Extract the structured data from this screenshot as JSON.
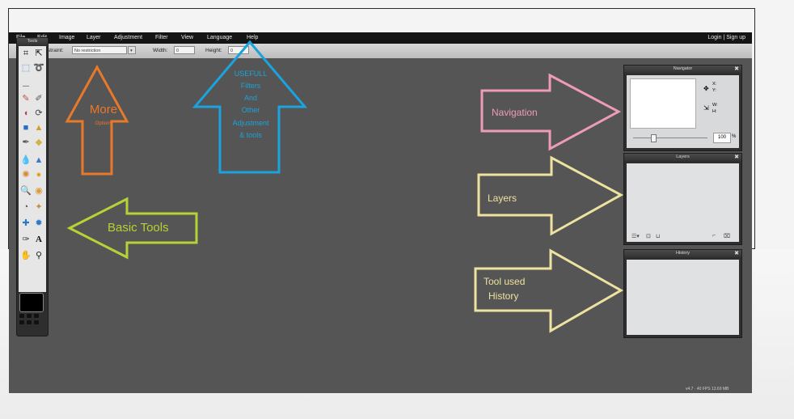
{
  "menu": {
    "items": [
      "File",
      "Edit",
      "Image",
      "Layer",
      "Adjustment",
      "Filter",
      "View",
      "Language",
      "Help"
    ],
    "login": "Login",
    "separator": "|",
    "signup": "Sign up"
  },
  "options": {
    "constraint_label": "Constraint:",
    "constraint_value": "No restriction",
    "width_label": "Width:",
    "width_value": "0",
    "height_label": "Height:",
    "height_value": "0"
  },
  "panels": {
    "tools_title": "Tools",
    "navigator_title": "Navigator",
    "navigator_x": "X:",
    "navigator_y": "Y:",
    "navigator_w": "W:",
    "navigator_h": "H:",
    "navigator_zoom": "100",
    "navigator_percent": "%",
    "layers_title": "Layers",
    "history_title": "History"
  },
  "annotations": {
    "more": "More",
    "more_sub": "Options",
    "useful_lines": [
      "USEFULL",
      "Filters",
      "And",
      "Other",
      "Adjustment",
      "& tools"
    ],
    "basic_tools": "Basic Tools",
    "navigation": "Navigation",
    "layers": "Layers",
    "tool_used": "Tool used",
    "history": "History"
  },
  "colors": {
    "orange": "#e8792a",
    "blue": "#1aa3dc",
    "green": "#b5d334",
    "pink": "#ee9cb5",
    "yellow": "#eee2a0"
  },
  "status": "v4.7 · 40 FPS 13.69 MB"
}
